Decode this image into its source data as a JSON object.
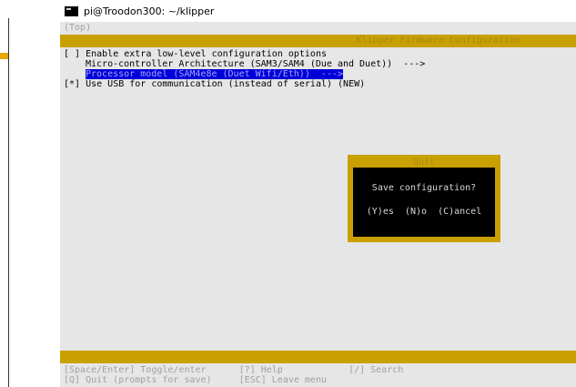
{
  "window": {
    "title": "pi@Troodon300: ~/klipper"
  },
  "terminal": {
    "breadcrumb": "(Top)",
    "menu_title": "Klipper Firmware Configuration",
    "items": [
      {
        "checkbox": "[ ]",
        "label": "Enable extra low-level configuration options"
      },
      {
        "label": "Micro-controller Architecture (SAM3/SAM4 (Due and Duet))  --->"
      },
      {
        "label": "Processor model (SAM4e8e (Duet Wifi/Eth))  --->"
      },
      {
        "checkbox": "[*]",
        "label": "Use USB for communication (instead of serial) (NEW)"
      }
    ],
    "footer": {
      "line1": "[Space/Enter] Toggle/enter      [?] Help            [/] Search",
      "line2": "[Q] Quit (prompts for save)     [ESC] Leave menu"
    }
  },
  "dialog": {
    "title": "Quit",
    "question": "Save configuration?",
    "yes": "(Y)es",
    "no": "(N)o",
    "cancel": "(C)ancel"
  },
  "colors": {
    "terminal_bg": "#e6e6e6",
    "bar_yellow": "#c8a000",
    "selection_blue": "#0000d8",
    "dialog_bg": "#000000"
  }
}
